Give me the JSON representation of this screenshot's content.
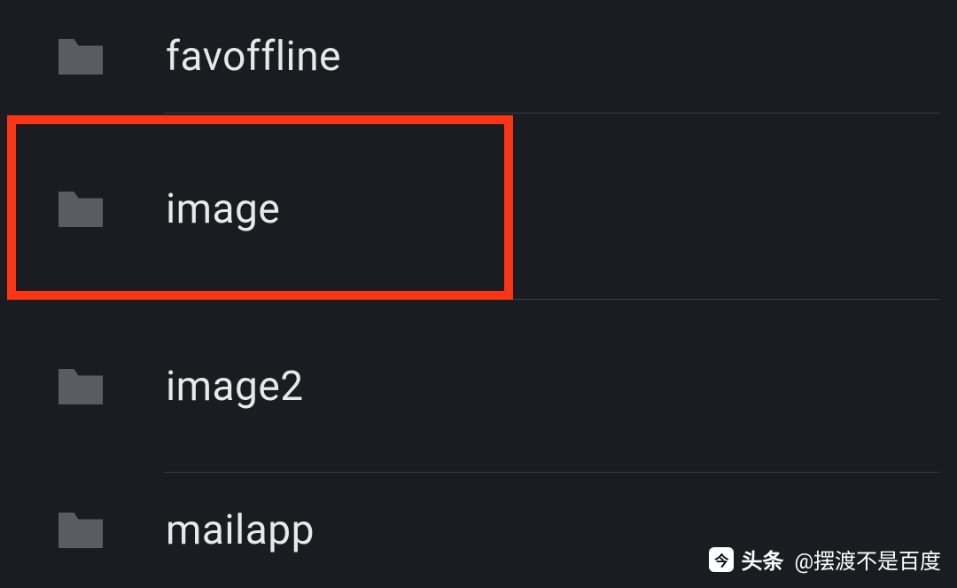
{
  "folders": [
    {
      "name": "favoffline"
    },
    {
      "name": "image"
    },
    {
      "name": "image2"
    },
    {
      "name": "mailapp"
    }
  ],
  "highlighted_index": 1,
  "watermark": {
    "brand": "头条",
    "handle": "@摆渡不是百度"
  }
}
